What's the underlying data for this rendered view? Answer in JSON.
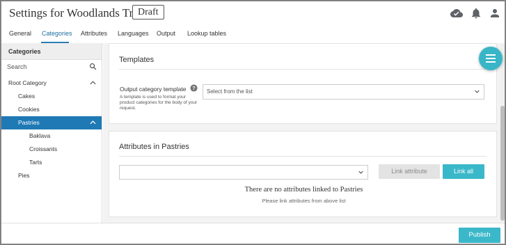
{
  "header": {
    "title": "Settings for Woodlands Treats",
    "status": "Draft",
    "icons": [
      "cloud-check-icon",
      "bell-icon",
      "user-icon"
    ]
  },
  "tabs": [
    {
      "label": "General",
      "active": false
    },
    {
      "label": "Categories",
      "active": true
    },
    {
      "label": "Attributes",
      "active": false
    },
    {
      "label": "Languages",
      "active": false
    },
    {
      "label": "Output",
      "active": false
    },
    {
      "label": "Lookup tables",
      "active": false
    }
  ],
  "sidebar": {
    "heading": "Categories",
    "search_placeholder": "Search",
    "tree": [
      {
        "label": "Root Category",
        "level": 0,
        "expanded": true,
        "selected": false
      },
      {
        "label": "Cakes",
        "level": 1,
        "selected": false
      },
      {
        "label": "Cookies",
        "level": 1,
        "selected": false
      },
      {
        "label": "Pastries",
        "level": 1,
        "expanded": true,
        "selected": true
      },
      {
        "label": "Baklava",
        "level": 2,
        "selected": false
      },
      {
        "label": "Croissants",
        "level": 2,
        "selected": false
      },
      {
        "label": "Tarts",
        "level": 2,
        "selected": false
      },
      {
        "label": "Pies",
        "level": 1,
        "selected": false
      }
    ]
  },
  "templates": {
    "title": "Templates",
    "field_label": "Output category template",
    "hint": "A template is used to format your product categories for the body of your request.",
    "select_placeholder": "Select from the list"
  },
  "attributes": {
    "title": "Attributes in Pastries",
    "select_value": "",
    "link_button": "Link attribute",
    "link_all_button": "Link all",
    "empty_title": "There are no attributes linked to Pastries",
    "empty_subtitle": "Please link attributes from above list"
  },
  "footer": {
    "publish_button": "Publish"
  },
  "colors": {
    "accent": "#3ab8c9",
    "selected": "#1f79b5",
    "tab_active": "#1f6f9e"
  }
}
